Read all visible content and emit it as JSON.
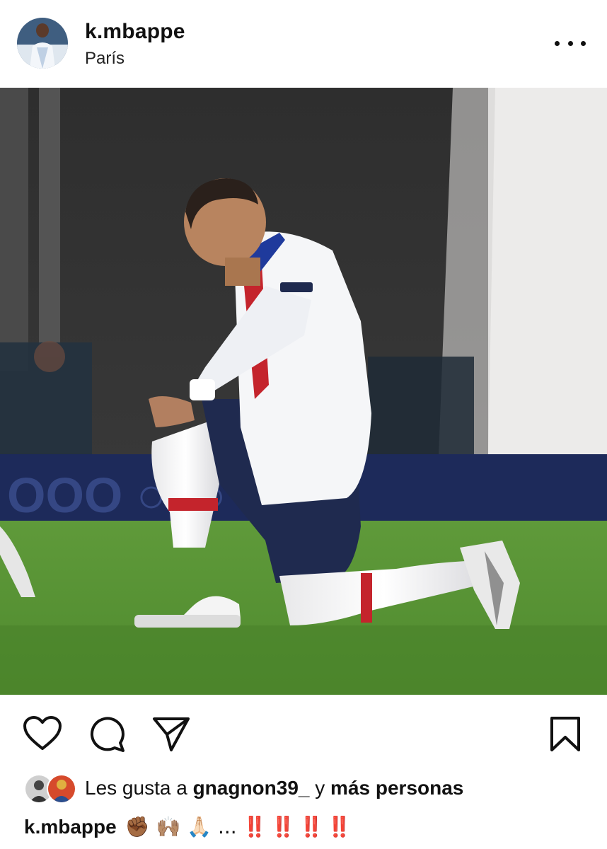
{
  "post": {
    "username": "k.mbappe",
    "location": "París"
  },
  "likes": {
    "prefix": "Les gusta a",
    "liker": "gnagnon39_",
    "joiner": "y",
    "others": "más personas"
  },
  "caption": {
    "username": "k.mbappe",
    "emojis": "✊🏾 🙌🏽 🙏🏻 ...",
    "exclamations": [
      "‼️",
      "‼️",
      "‼️",
      "‼️"
    ]
  },
  "icons": {
    "more": "more-options-icon",
    "like": "heart-icon",
    "comment": "comment-icon",
    "share": "send-icon",
    "save": "bookmark-icon"
  }
}
